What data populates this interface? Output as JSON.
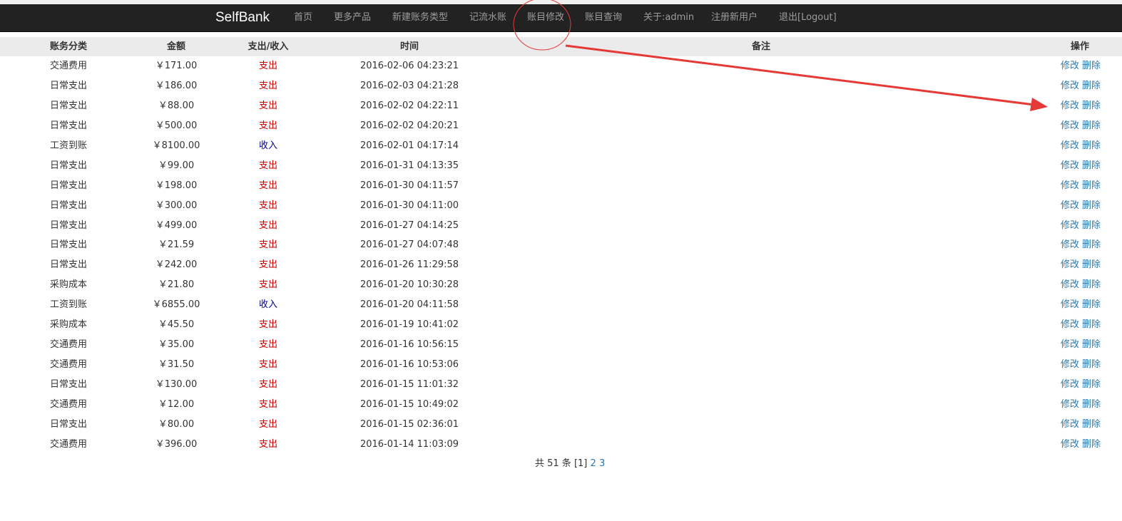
{
  "navbar": {
    "brand": "SelfBank",
    "items": [
      "首页",
      "更多产品",
      "新建账务类型",
      "记流水账",
      "账目修改",
      "账目查询",
      "关于:admin",
      "注册新用户",
      "退出[Logout]"
    ]
  },
  "table": {
    "headers": {
      "category": "账务分类",
      "amount": "金额",
      "flow": "支出/收入",
      "time": "时间",
      "note": "备注",
      "ops": "操作"
    },
    "edit_label": "修改",
    "delete_label": "删除",
    "rows": [
      {
        "category": "交通费用",
        "amount": "￥171.00",
        "flow": "支出",
        "time": "2016-02-06 04:23:21"
      },
      {
        "category": "日常支出",
        "amount": "￥186.00",
        "flow": "支出",
        "time": "2016-02-03 04:21:28"
      },
      {
        "category": "日常支出",
        "amount": "￥88.00",
        "flow": "支出",
        "time": "2016-02-02 04:22:11"
      },
      {
        "category": "日常支出",
        "amount": "￥500.00",
        "flow": "支出",
        "time": "2016-02-02 04:20:21"
      },
      {
        "category": "工资到账",
        "amount": "￥8100.00",
        "flow": "收入",
        "time": "2016-02-01 04:17:14"
      },
      {
        "category": "日常支出",
        "amount": "￥99.00",
        "flow": "支出",
        "time": "2016-01-31 04:13:35"
      },
      {
        "category": "日常支出",
        "amount": "￥198.00",
        "flow": "支出",
        "time": "2016-01-30 04:11:57"
      },
      {
        "category": "日常支出",
        "amount": "￥300.00",
        "flow": "支出",
        "time": "2016-01-30 04:11:00"
      },
      {
        "category": "日常支出",
        "amount": "￥499.00",
        "flow": "支出",
        "time": "2016-01-27 04:14:25"
      },
      {
        "category": "日常支出",
        "amount": "￥21.59",
        "flow": "支出",
        "time": "2016-01-27 04:07:48"
      },
      {
        "category": "日常支出",
        "amount": "￥242.00",
        "flow": "支出",
        "time": "2016-01-26 11:29:58"
      },
      {
        "category": "采购成本",
        "amount": "￥21.80",
        "flow": "支出",
        "time": "2016-01-20 10:30:28"
      },
      {
        "category": "工资到账",
        "amount": "￥6855.00",
        "flow": "收入",
        "time": "2016-01-20 04:11:58"
      },
      {
        "category": "采购成本",
        "amount": "￥45.50",
        "flow": "支出",
        "time": "2016-01-19 10:41:02"
      },
      {
        "category": "交通费用",
        "amount": "￥35.00",
        "flow": "支出",
        "time": "2016-01-16 10:56:15"
      },
      {
        "category": "交通费用",
        "amount": "￥31.50",
        "flow": "支出",
        "time": "2016-01-16 10:53:06"
      },
      {
        "category": "日常支出",
        "amount": "￥130.00",
        "flow": "支出",
        "time": "2016-01-15 11:01:32"
      },
      {
        "category": "交通费用",
        "amount": "￥12.00",
        "flow": "支出",
        "time": "2016-01-15 10:49:02"
      },
      {
        "category": "日常支出",
        "amount": "￥80.00",
        "flow": "支出",
        "time": "2016-01-15 02:36:01"
      },
      {
        "category": "交通费用",
        "amount": "￥396.00",
        "flow": "支出",
        "time": "2016-01-14 11:03:09"
      }
    ]
  },
  "pagination": {
    "summary": "共 51 条",
    "current": "[1]",
    "pages": [
      "2",
      "3"
    ]
  },
  "colors": {
    "expense": "#cc0000",
    "income": "#000099",
    "link": "#2a7ab0",
    "annotation": "#e53935"
  }
}
